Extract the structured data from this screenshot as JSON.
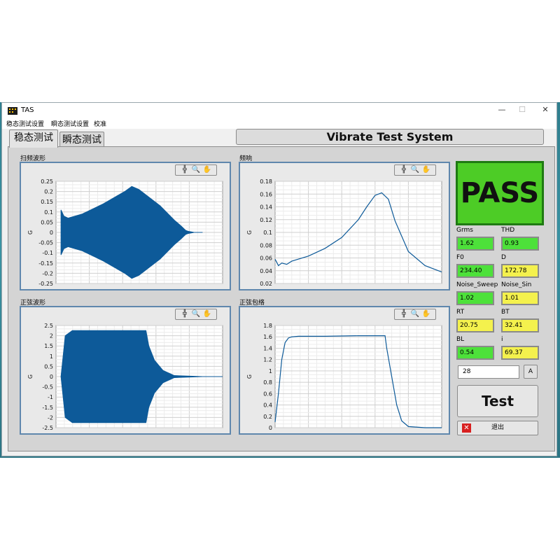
{
  "window": {
    "title": "TAS",
    "minimize": "—",
    "maximize": "☐",
    "close": "✕"
  },
  "menu": [
    "稳态测试设置",
    "瞬态测试设置",
    "校准"
  ],
  "tabs": [
    "稳态测试",
    "瞬态测试"
  ],
  "header": "Vibrate Test System",
  "charts": [
    {
      "title": "扫频波形",
      "chart_data": {
        "type": "area",
        "title": "扫频波形",
        "xlabel": "",
        "ylabel": "G",
        "ylim": [
          -0.25,
          0.25
        ],
        "yticks": [
          "0.25",
          "0.2",
          "0.15",
          "0.1",
          "0.05",
          "0",
          "-0.05",
          "-0.1",
          "-0.15",
          "-0.2",
          "-0.25"
        ],
        "envelope": {
          "x": [
            0,
            0.02,
            0.05,
            0.15,
            0.3,
            0.45,
            0.5,
            0.55,
            0.7,
            0.8,
            0.85,
            0.88,
            0.9,
            0.94,
            1.0
          ],
          "upper": [
            0.11,
            0.08,
            0.07,
            0.09,
            0.14,
            0.2,
            0.225,
            0.21,
            0.13,
            0.06,
            0.03,
            0.01,
            0.005,
            0.0,
            0.0
          ],
          "lower": [
            -0.11,
            -0.08,
            -0.07,
            -0.09,
            -0.14,
            -0.2,
            -0.225,
            -0.21,
            -0.13,
            -0.06,
            -0.03,
            -0.01,
            -0.005,
            0.0,
            0.0
          ]
        },
        "series_color": "#0d5a99",
        "grid": true
      }
    },
    {
      "title": "频响",
      "chart_data": {
        "type": "line",
        "title": "频响",
        "xlabel": "",
        "ylabel": "G",
        "ylim": [
          0.02,
          0.18
        ],
        "yticks": [
          "0.18",
          "0.16",
          "0.14",
          "0.12",
          "0.1",
          "0.08",
          "0.06",
          "0.04",
          "0.02"
        ],
        "x": [
          0,
          0.02,
          0.04,
          0.07,
          0.1,
          0.2,
          0.3,
          0.4,
          0.5,
          0.55,
          0.6,
          0.64,
          0.68,
          0.72,
          0.8,
          0.9,
          1.0
        ],
        "y": [
          0.058,
          0.048,
          0.052,
          0.05,
          0.055,
          0.063,
          0.075,
          0.092,
          0.12,
          0.14,
          0.158,
          0.162,
          0.152,
          0.118,
          0.07,
          0.048,
          0.038
        ],
        "series_color": "#0d5a99",
        "grid": true
      }
    },
    {
      "title": "正弦波形",
      "chart_data": {
        "type": "area",
        "title": "正弦波形",
        "xlabel": "",
        "ylabel": "G",
        "ylim": [
          -2.5,
          2.5
        ],
        "yticks": [
          "2.5",
          "2",
          "1.5",
          "1",
          "0.5",
          "0",
          "-0.5",
          "-1",
          "-1.5",
          "-2",
          "-2.5"
        ],
        "envelope": {
          "x": [
            0,
            0.03,
            0.08,
            0.6,
            0.62,
            0.66,
            0.72,
            0.8,
            1.0
          ],
          "upper": [
            0,
            2.0,
            2.25,
            2.25,
            1.5,
            0.8,
            0.3,
            0.05,
            0.0
          ],
          "lower": [
            0,
            -2.0,
            -2.25,
            -2.25,
            -1.5,
            -0.8,
            -0.3,
            -0.05,
            0.0
          ]
        },
        "series_color": "#0d5a99",
        "grid": true
      }
    },
    {
      "title": "正弦包络",
      "chart_data": {
        "type": "line",
        "title": "正弦包络",
        "xlabel": "",
        "ylabel": "G",
        "ylim": [
          0,
          1.8
        ],
        "yticks": [
          "1.8",
          "1.6",
          "1.4",
          "1.2",
          "1",
          "0.8",
          "0.6",
          "0.4",
          "0.2",
          "0"
        ],
        "x": [
          0,
          0.02,
          0.04,
          0.06,
          0.08,
          0.1,
          0.14,
          0.3,
          0.5,
          0.66,
          0.67,
          0.7,
          0.73,
          0.76,
          0.8,
          0.9,
          1.0
        ],
        "y": [
          0.1,
          0.6,
          1.2,
          1.5,
          1.58,
          1.6,
          1.61,
          1.61,
          1.62,
          1.62,
          1.4,
          0.9,
          0.4,
          0.12,
          0.02,
          0.0,
          0.0
        ],
        "series_color": "#0d5a99",
        "grid": true
      }
    }
  ],
  "chart_tools": [
    "╬",
    "🔍",
    "✋"
  ],
  "result": "PASS",
  "metrics": [
    {
      "label": "Grms",
      "value": "1.62",
      "color": "green"
    },
    {
      "label": "THD",
      "value": "0.93",
      "color": "green"
    },
    {
      "label": "F0",
      "value": "234.40",
      "color": "green"
    },
    {
      "label": "D",
      "value": "172.78",
      "color": "yellow"
    },
    {
      "label": "Noise_Sweep",
      "value": "1.02",
      "color": "green"
    },
    {
      "label": "Noise_Sin",
      "value": "1.01",
      "color": "yellow"
    },
    {
      "label": "RT",
      "value": "20.75",
      "color": "yellow"
    },
    {
      "label": "BT",
      "value": "32.41",
      "color": "yellow"
    },
    {
      "label": "BL",
      "value": "0.54",
      "color": "green"
    },
    {
      "label": "i",
      "value": "69.37",
      "color": "yellow"
    }
  ],
  "count_input": "28",
  "a_button": "A",
  "test_button": "Test",
  "exit_button": "退出"
}
